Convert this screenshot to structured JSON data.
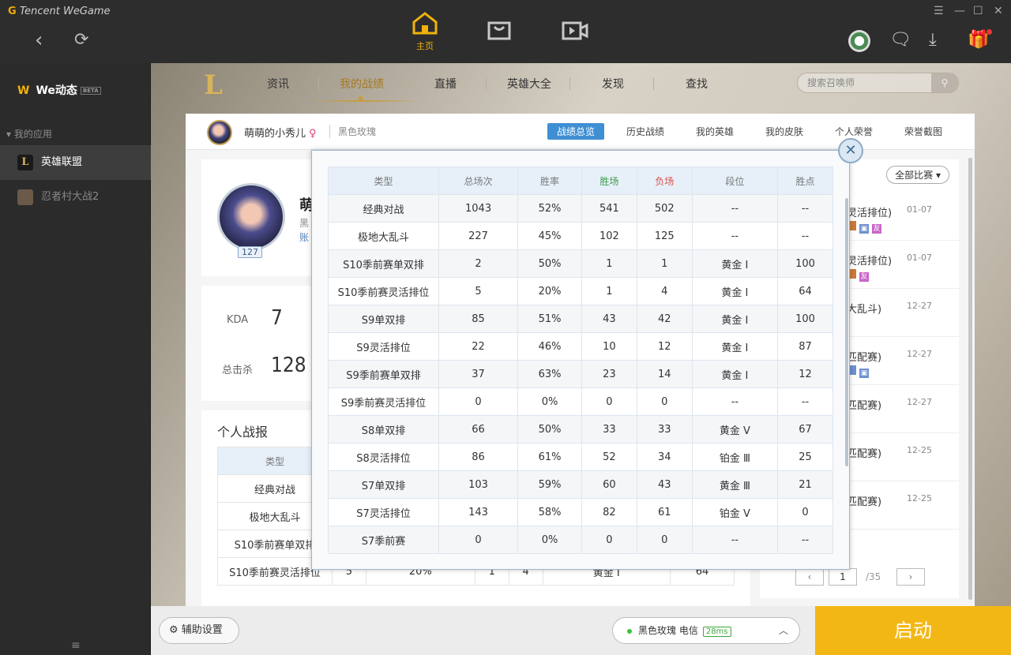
{
  "app": {
    "brand_prefix": "G",
    "brand": "Tencent WeGame"
  },
  "top": {
    "home_label": "主页"
  },
  "sidebar": {
    "we": "We动态",
    "beta": "BETA",
    "my_apps": "我的应用",
    "apps": [
      {
        "label": "英雄联盟"
      },
      {
        "label": "忍者村大战2"
      }
    ]
  },
  "nav": {
    "tabs": [
      "资讯",
      "我的战绩",
      "直播",
      "英雄大全",
      "发现",
      "查找"
    ],
    "active": "我的战绩",
    "search_placeholder": "搜索召唤师"
  },
  "profile": {
    "name": "萌萌的小秀儿",
    "server": "黑色玫瑰",
    "big_name": "萌",
    "sub1": "黑",
    "sub2": "账",
    "level": "127",
    "subtabs": [
      "战绩总览",
      "历史战绩",
      "我的英雄",
      "我的皮肤",
      "个人荣誉",
      "荣誉截图"
    ]
  },
  "stats": {
    "kda_label": "KDA",
    "kda": "7",
    "kills_label": "总击杀",
    "kills": "128"
  },
  "report": {
    "title": "个人战报",
    "header": "类型",
    "rows": [
      "经典对战",
      "极地大乱斗",
      "S10季前赛单双排",
      "S10季前赛灵活排位"
    ],
    "last_row_vals": [
      "5",
      "20%",
      "1",
      "4",
      "黄金 Ⅰ",
      "64"
    ]
  },
  "matches": {
    "filter": "全部比赛",
    "items": [
      {
        "title": "灵活排位)",
        "date": "01-07"
      },
      {
        "title": "灵活排位)",
        "date": "01-07"
      },
      {
        "title": "大乱斗)",
        "date": "12-27"
      },
      {
        "title": "匹配赛)",
        "date": "12-27"
      },
      {
        "title": "匹配赛)",
        "date": "12-27"
      },
      {
        "title": "匹配赛)",
        "date": "12-25"
      },
      {
        "title": "匹配赛)",
        "date": "12-25"
      }
    ],
    "tag_friend": "友",
    "page": "1",
    "total": "/35"
  },
  "bottom": {
    "assist": "辅助设置",
    "server": "黑色玫瑰 电信",
    "ping": "28ms",
    "launch": "启动"
  },
  "modal": {
    "columns": [
      "类型",
      "总场次",
      "胜率",
      "胜场",
      "负场",
      "段位",
      "胜点"
    ],
    "rows": [
      [
        "经典对战",
        "1043",
        "52%",
        "541",
        "502",
        "--",
        "--"
      ],
      [
        "极地大乱斗",
        "227",
        "45%",
        "102",
        "125",
        "--",
        "--"
      ],
      [
        "S10季前赛单双排",
        "2",
        "50%",
        "1",
        "1",
        "黄金 Ⅰ",
        "100"
      ],
      [
        "S10季前赛灵活排位",
        "5",
        "20%",
        "1",
        "4",
        "黄金 Ⅰ",
        "64"
      ],
      [
        "S9单双排",
        "85",
        "51%",
        "43",
        "42",
        "黄金 Ⅰ",
        "100"
      ],
      [
        "S9灵活排位",
        "22",
        "46%",
        "10",
        "12",
        "黄金 Ⅰ",
        "87"
      ],
      [
        "S9季前赛单双排",
        "37",
        "63%",
        "23",
        "14",
        "黄金 Ⅰ",
        "12"
      ],
      [
        "S9季前赛灵活排位",
        "0",
        "0%",
        "0",
        "0",
        "--",
        "--"
      ],
      [
        "S8单双排",
        "66",
        "50%",
        "33",
        "33",
        "黄金 Ⅴ",
        "67"
      ],
      [
        "S8灵活排位",
        "86",
        "61%",
        "52",
        "34",
        "铂金 Ⅲ",
        "25"
      ],
      [
        "S7单双排",
        "103",
        "59%",
        "60",
        "43",
        "黄金 Ⅲ",
        "21"
      ],
      [
        "S7灵活排位",
        "143",
        "58%",
        "82",
        "61",
        "铂金 Ⅴ",
        "0"
      ],
      [
        "S7季前赛",
        "0",
        "0%",
        "0",
        "0",
        "--",
        "--"
      ]
    ]
  }
}
